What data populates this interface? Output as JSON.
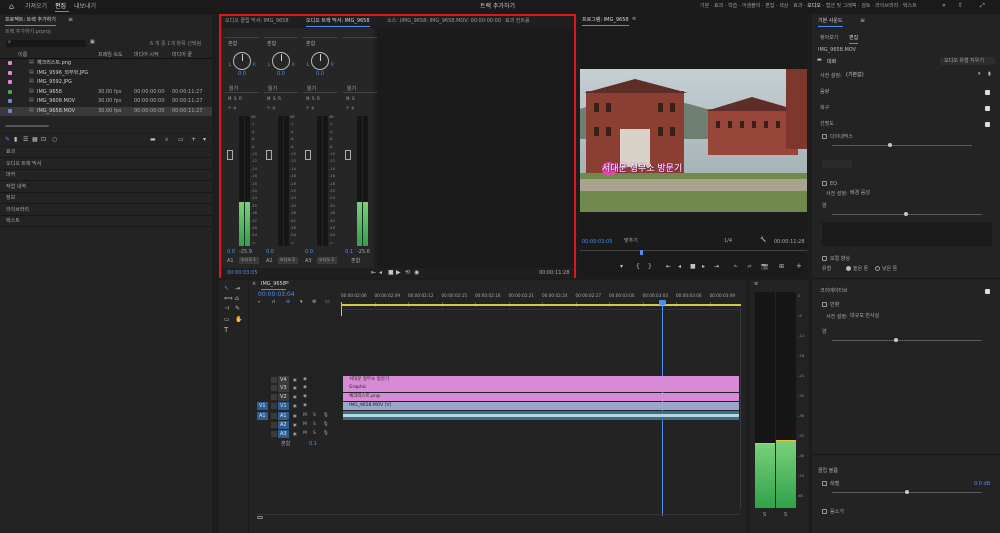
{
  "topbar": {
    "home_icon": "home-icon",
    "tabs": [
      "가져오기",
      "편집",
      "내보내기"
    ],
    "active_tab": "편집",
    "title": "트랙 추가하기",
    "workspaces": [
      "기본",
      "효과",
      "학습",
      "어셈블리",
      "편집",
      "색상",
      "효과",
      "오디오",
      "캡션 및 그래픽",
      "검토",
      "라이브러리",
      "텍스트"
    ],
    "active_workspace": "오디오"
  },
  "project": {
    "title": "프로젝트: 트랙 추가하기",
    "path": "트랙 추가하기.prproj",
    "selection": "6 개 중 1개 항목 선택됨",
    "columns": [
      "이름",
      "프레임 속도",
      "미디어 시작",
      "미디어 끝"
    ],
    "items": [
      {
        "name": "체크리스트.png",
        "fps": "",
        "start": "",
        "end": "",
        "color": "#d98ad6"
      },
      {
        "name": "IMG_9596_외부와.JPG",
        "fps": "",
        "start": "",
        "end": "",
        "color": "#d98ad6"
      },
      {
        "name": "IMG_9592.JPG",
        "fps": "",
        "start": "",
        "end": "",
        "color": "#d98ad6"
      },
      {
        "name": "IMG_9658",
        "fps": "30.00 fps",
        "start": "00:00:00:00",
        "end": "00:00:11:27",
        "color": "#3fae49"
      },
      {
        "name": "IMG_9608.MOV",
        "fps": "30.00 fps",
        "start": "00:00:00:00",
        "end": "00:00:11:27",
        "color": "#6d86d9"
      },
      {
        "name": "IMG_9658.MOV",
        "fps": "30.00 fps",
        "start": "00:00:00:00",
        "end": "00:00:11:27",
        "color": "#6d86d9"
      }
    ]
  },
  "left_panels": [
    "효과",
    "오디오 트랙 믹서",
    "마커",
    "작업 내역",
    "정보",
    "라이브러리",
    "텍스트"
  ],
  "mixer": {
    "tabs": [
      "오디오 클립 믹서: IMG_9658",
      "오디오 트랙 믹서: IMG_9658",
      "소스: (IMG_9658: IMG_9658.MOV: 00:00:00:00",
      "효과 컨트롤"
    ],
    "channels": [
      {
        "name": "A1",
        "label": "오디오 1",
        "mode": "읽기",
        "value": "0.0",
        "value2": "-25.9",
        "fill": 0.34
      },
      {
        "name": "A2",
        "label": "오디오 2",
        "mode": "읽기",
        "value": "0.0",
        "value2": "",
        "fill": 0
      },
      {
        "name": "A3",
        "label": "오디오 3",
        "mode": "읽기",
        "value": "0.0",
        "value2": "",
        "fill": 0
      },
      {
        "name": "Mix",
        "label": "혼합",
        "mode": "읽기",
        "value": "0.1",
        "value2": "-25.6",
        "fill": 0.34
      }
    ],
    "scale": [
      "dB",
      "-2",
      "-4",
      "-6",
      "-8",
      "-10",
      "-12",
      "-14",
      "-16",
      "-18",
      "-20",
      "-24",
      "-30",
      "-36",
      "-42",
      "-48",
      "-54",
      "-∞"
    ],
    "timecode_left": "00:00:03:05",
    "timecode_right": "00:00:11:28",
    "mix_label": "혼합"
  },
  "program": {
    "title": "프로그램: IMG_9658",
    "timecode_left": "00:00:03:05",
    "timecode_right": "00:00:11:28",
    "fit": "맞추기",
    "quality": "1/4",
    "caption": "서대문 형무소 방문기"
  },
  "timeline": {
    "tab": "IMG_9658",
    "timecode": "00:00:03:04",
    "ruler": [
      "00:00:02:06",
      "00:00:02:09",
      "00:00:02:12",
      "00:00:02:15",
      "00:00:02:18",
      "00:00:02:21",
      "00:00:02:24",
      "00:00:02:27",
      "00:00:03:00",
      "00:00:03:03",
      "00:00:03:06",
      "00:00:03:09"
    ],
    "video_tracks": [
      "V4",
      "V3",
      "V2",
      "V1"
    ],
    "audio_tracks": [
      "A1",
      "A2",
      "A3"
    ],
    "mix_label": "혼합",
    "mix_value": "0.1",
    "clips": [
      {
        "label": "서대문 형무소 방문기",
        "color": "#d98ad6"
      },
      {
        "label": "Graphic",
        "color": "#d98ad6"
      },
      {
        "label": "체크리스트.png",
        "color": "#d98ad6"
      },
      {
        "label": "IMG_9658.MOV [V]",
        "color": "#9aa7c8"
      }
    ]
  },
  "essential_sound": {
    "title": "기본 사운드",
    "tabs": [
      "찾아보기",
      "편집"
    ],
    "clip": "IMG_9658.MOV",
    "type": "대화",
    "clear_label": "오디오 유형 지우기",
    "preset_label": "사전 설정:",
    "preset_value": "(기본값)",
    "sections": [
      "음량",
      "복구",
      "선명도"
    ],
    "dynamics": "다이내믹스",
    "eq": "EQ",
    "eq_preset_label": "사전 설정:",
    "eq_preset_value": "배경 음성",
    "amount": "양",
    "enhance": "보컬 향상",
    "type_label": "유형",
    "low": "높은 톤",
    "high": "낮은 톤",
    "creative": "크리에이티브",
    "reverb": "반향",
    "reverb_preset_label": "사전 설정:",
    "reverb_preset_value": "대규모 반사실",
    "clip_volume": "클립 볼륨",
    "level": "레벨",
    "level_value": "0.0 dB",
    "mute": "음소거"
  },
  "meters": {
    "scale": [
      "0",
      "-6",
      "-12",
      "-18",
      "-24",
      "-30",
      "-36",
      "-42",
      "-48",
      "-54",
      "dB"
    ],
    "left": 0.3,
    "right": 0.3,
    "labels": [
      "S",
      "S"
    ]
  }
}
